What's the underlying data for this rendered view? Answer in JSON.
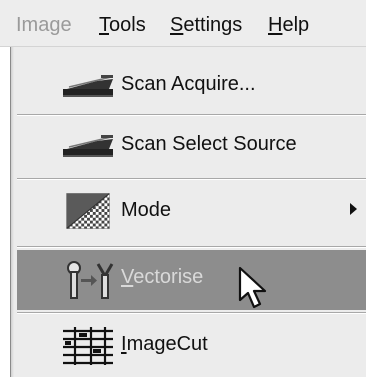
{
  "menubar": {
    "items": [
      {
        "label": "Image",
        "underline": "",
        "rest": "",
        "disabled": true
      },
      {
        "label": "",
        "underline": "T",
        "rest": "ools",
        "disabled": false
      },
      {
        "label": "",
        "underline": "S",
        "rest": "ettings",
        "disabled": false
      },
      {
        "label": "",
        "underline": "H",
        "rest": "elp",
        "disabled": false
      }
    ]
  },
  "dropdown": {
    "items": [
      {
        "label": "Scan Acquire...",
        "icon": "scanner-icon"
      },
      {
        "label": "Scan Select Source",
        "icon": "scanner-icon"
      },
      {
        "label": "Mode",
        "icon": "mode-icon",
        "has_submenu": true
      },
      {
        "underline": "V",
        "rest": "ectorise",
        "icon": "vectorise-icon",
        "highlighted": true
      },
      {
        "underline": "I",
        "rest": "mageCut",
        "icon": "imagecut-icon"
      }
    ]
  },
  "colors": {
    "menubar_bg": "#ededed",
    "menu_bg": "#ececec",
    "highlight_bg": "#8d8d8d",
    "highlight_text": "#d9d9d9",
    "disabled_text": "#9a9a9a"
  }
}
